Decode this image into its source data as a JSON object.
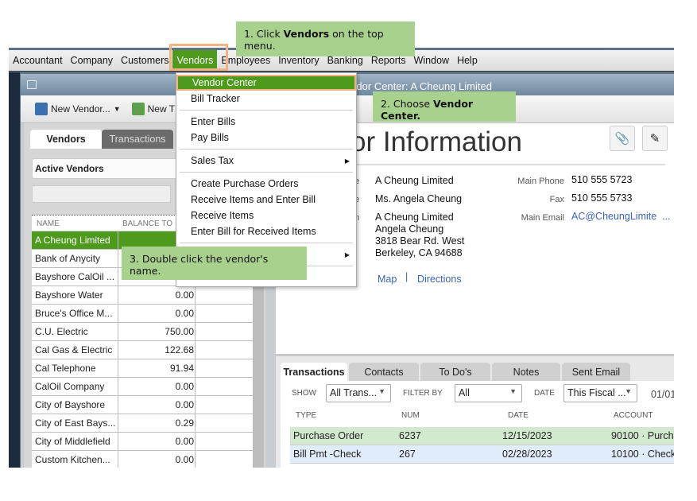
{
  "menubar": {
    "items": [
      "Accountant",
      "Company",
      "Customers",
      "Vendors",
      "Employees",
      "Inventory",
      "Banking",
      "Reports",
      "Window",
      "Help"
    ],
    "active": "Vendors"
  },
  "vendors_menu": {
    "items": [
      {
        "label": "Vendor Center",
        "highlighted": true
      },
      {
        "label": "Bill Tracker"
      },
      {
        "label": "Enter Bills"
      },
      {
        "label": "Pay Bills"
      },
      {
        "label": "Sales Tax",
        "submenu": true
      },
      {
        "label": "Create Purchase Orders"
      },
      {
        "label": "Receive Items and Enter Bill"
      },
      {
        "label": "Receive Items"
      },
      {
        "label": "Enter Bill for Received Items"
      }
    ]
  },
  "window": {
    "title": "Vendor Center: A Cheung Limited"
  },
  "toolbar": {
    "new_vendor": "New Vendor...",
    "new_transactions": "New T"
  },
  "left_panel": {
    "tabs": [
      "Vendors",
      "Transactions"
    ],
    "filter": "Active Vendors",
    "columns": [
      "NAME",
      "BALANCE TO"
    ],
    "rows": [
      {
        "name": "A Cheung Limited",
        "balance": ""
      },
      {
        "name": "Bank of Anycity",
        "balance": ""
      },
      {
        "name": "Bayshore CalOil ...",
        "balance": ""
      },
      {
        "name": "Bayshore Water",
        "balance": "0.00"
      },
      {
        "name": "Bruce's Office M...",
        "balance": "0.00"
      },
      {
        "name": "C.U. Electric",
        "balance": "750.00"
      },
      {
        "name": "Cal Gas & Electric",
        "balance": "122.68"
      },
      {
        "name": "Cal Telephone",
        "balance": "91.94"
      },
      {
        "name": "CalOil Company",
        "balance": "0.00"
      },
      {
        "name": "City of Bayshore",
        "balance": "0.00"
      },
      {
        "name": "City of East Bays...",
        "balance": "0.29"
      },
      {
        "name": "City of Middlefield",
        "balance": "0.00"
      },
      {
        "name": "Custom Kitchen...",
        "balance": "0.00"
      }
    ]
  },
  "vendor_info": {
    "heading": "or Information",
    "labels": [
      "me",
      "me",
      "om"
    ],
    "company_name": "A Cheung Limited",
    "contact": "Ms. Angela  Cheung",
    "address": [
      "A Cheung Limited",
      "Angela Cheung",
      "3818 Bear Rd. West",
      "Berkeley, CA 94688"
    ],
    "map": "Map",
    "directions": "Directions",
    "main_phone_label": "Main Phone",
    "main_phone": "510 555 5723",
    "fax_label": "Fax",
    "fax": "510 555 5733",
    "email_label": "Main Email",
    "email": "AC@CheungLimite",
    "email_more": "..."
  },
  "lower": {
    "tabs": [
      "Transactions",
      "Contacts",
      "To Do's",
      "Notes",
      "Sent Email"
    ],
    "show_label": "SHOW",
    "show": "All Trans...",
    "filter_label": "FILTER BY",
    "filter": "All",
    "date_label": "DATE",
    "date": "This Fiscal ...",
    "date_range": "01/01",
    "columns": [
      "TYPE",
      "NUM",
      "DATE",
      "ACCOUNT"
    ],
    "rows": [
      {
        "type": "Purchase Order",
        "num": "6237",
        "date": "12/15/2023",
        "account": "90100 · Purch"
      },
      {
        "type": "Bill Pmt -Check",
        "num": "267",
        "date": "02/28/2023",
        "account": "10100 · Check"
      }
    ]
  },
  "callouts": {
    "step1_pre": "1. Click ",
    "step1_bold": "Vendors",
    "step1_post": " on the top menu.",
    "step2_pre": "2. Choose ",
    "step2_bold": "Vendor Center.",
    "step3": "3. Double click the vendor's name."
  },
  "colors": {
    "accent": "#4e9a1c",
    "callout": "#a9d18e",
    "highlight_border": "#f4b183"
  }
}
